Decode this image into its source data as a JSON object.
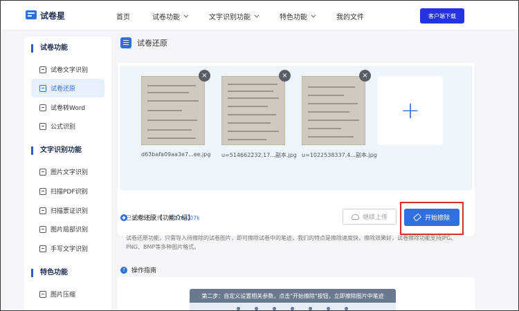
{
  "header": {
    "logo_text": "试卷星",
    "nav": [
      {
        "label": "首页",
        "dropdown": false
      },
      {
        "label": "试卷功能",
        "dropdown": true
      },
      {
        "label": "文字识别功能",
        "dropdown": true
      },
      {
        "label": "特色功能",
        "dropdown": true
      },
      {
        "label": "我的文件",
        "dropdown": false
      }
    ],
    "download_label": "客户端下载"
  },
  "sidebar": {
    "sections": [
      {
        "title": "试卷功能",
        "items": [
          {
            "label": "试卷文字识别",
            "active": false
          },
          {
            "label": "试卷还原",
            "active": true
          },
          {
            "label": "试卷转Word",
            "active": false
          },
          {
            "label": "公式识别",
            "active": false
          }
        ]
      },
      {
        "title": "文字识别功能",
        "items": [
          {
            "label": "图片文字识别",
            "active": false
          },
          {
            "label": "扫描PDF识别",
            "active": false
          },
          {
            "label": "扫描票证识别",
            "active": false
          },
          {
            "label": "图片局部识别",
            "active": false
          },
          {
            "label": "手写文字识别",
            "active": false
          }
        ]
      },
      {
        "title": "特色功能",
        "items": [
          {
            "label": "图片压缩",
            "active": false
          }
        ]
      }
    ]
  },
  "main": {
    "page_title": "试卷还原",
    "files": [
      {
        "name": "d63bafa09aa3e7...ee.jpg"
      },
      {
        "name": "u=514662232,17...副本.jpg"
      },
      {
        "name": "u=1022538337,4...副本.jpg"
      }
    ],
    "add_symbol": "+",
    "remove_symbol": "×",
    "summary_prefix": "已上传3份文件，共",
    "summary_size": "2264.07k",
    "continue_label": "继续上传",
    "start_label": "开始擦除",
    "intro_title": "试卷还原【功能介绍】",
    "intro_text": "试卷还原功能，只需导入待擦除的试卷图片，即可擦除试卷中的笔迹，我们的特点是擦除速度快，擦除效果好，试卷擦除功能支持JPG、PNG、BMP等多种图片格式。",
    "guide_title": "操作指南",
    "step_banner": "第二步：自定义设置相关参数，点击\"开始擦除\"按钮，立即擦除图片中笔迹"
  },
  "colors": {
    "accent": "#2f6fe0",
    "brand_button": "#2434e0",
    "highlight_box": "#e02a2a"
  }
}
